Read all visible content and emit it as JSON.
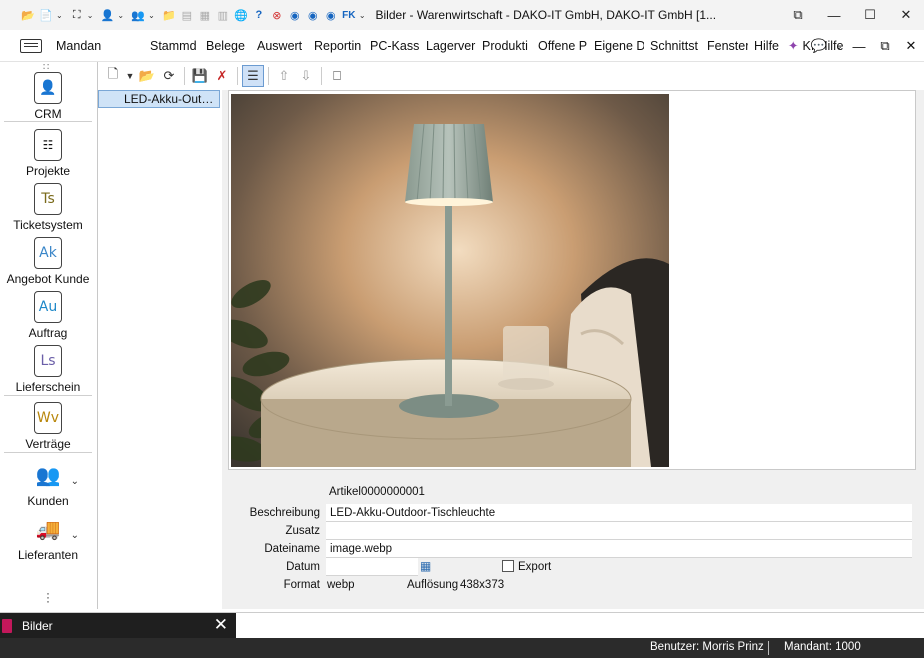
{
  "window": {
    "title": "Bilder - Warenwirtschaft - DAKO-IT GmbH, DAKO-IT GmbH [1...",
    "controls": [
      "restore-icon",
      "minimize-icon",
      "maximize-icon",
      "close-icon"
    ]
  },
  "menu": {
    "items": [
      "Mandan",
      "Stammd",
      "Belege",
      "Auswert",
      "Reportin",
      "PC-Kass",
      "Lagerver",
      "Produkti",
      "Offene P",
      "Eigene D",
      "Schnittst",
      "Fenster",
      "Hilfe"
    ],
    "ai_label": "KI-Hilfe"
  },
  "sidebar": {
    "items": [
      {
        "label": "CRM",
        "icon": "crm-icon",
        "glyph": "👤"
      },
      {
        "label": "Projekte",
        "icon": "projects-icon",
        "glyph": "⋮"
      },
      {
        "label": "Ticketsystem",
        "icon": "ticket-icon",
        "glyph": "Ts"
      },
      {
        "label": "Angebot Kunde",
        "icon": "offer-icon",
        "glyph": "Ak"
      },
      {
        "label": "Auftrag",
        "icon": "order-icon",
        "glyph": "Au"
      },
      {
        "label": "Lieferschein",
        "icon": "delivery-note-icon",
        "glyph": "Ls"
      },
      {
        "label": "Verträge",
        "icon": "contracts-icon",
        "glyph": "Wv"
      },
      {
        "label": "Kunden",
        "icon": "customers-icon",
        "glyph": "👥"
      },
      {
        "label": "Lieferanten",
        "icon": "suppliers-icon",
        "glyph": "🚚"
      }
    ]
  },
  "tree": {
    "selected_item": "LED-Akku-Outdoor-Tischleuchte"
  },
  "form": {
    "artikel_label": "Artikel",
    "artikel_value": "0000000001",
    "beschreibung_label": "Beschreibung",
    "beschreibung_value": "LED-Akku-Outdoor-Tischleuchte",
    "zusatz_label": "Zusatz",
    "zusatz_value": "",
    "dateiname_label": "Dateiname",
    "dateiname_value": "image.webp",
    "datum_label": "Datum",
    "datum_value": "",
    "export_label": "Export",
    "export_checked": false,
    "format_label": "Format",
    "format_value": "webp",
    "aufloesung_label": "Auflösung",
    "aufloesung_value": "438x373"
  },
  "tabs": {
    "active_label": "Bilder"
  },
  "status": {
    "user": "Benutzer: Morris Prinz",
    "mandant": "Mandant: 1000"
  }
}
